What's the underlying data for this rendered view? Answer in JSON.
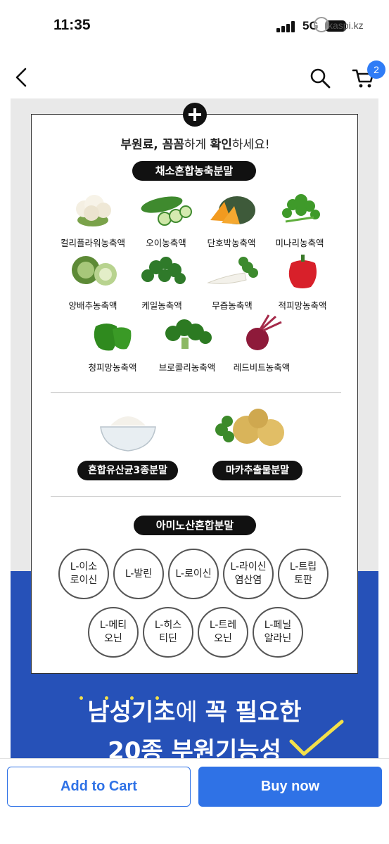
{
  "status_bar": {
    "time": "11:35",
    "network": "5G",
    "watermark": "kaspi.kz"
  },
  "header": {
    "cart_count": "2",
    "icons": [
      "back-arrow-icon",
      "search-icon",
      "cart-icon"
    ]
  },
  "product_image": {
    "subtitle": {
      "part1": "부원료, ",
      "part2": "꼼꼼",
      "part3": "하게 ",
      "part4": "확인",
      "part5": "하세요!"
    },
    "vegetable_section": {
      "title": "채소혼합농축분말",
      "items": [
        {
          "name": "컬리플라워농축액",
          "icon": "cauliflower"
        },
        {
          "name": "오이농축액",
          "icon": "cucumber"
        },
        {
          "name": "단호박농축액",
          "icon": "pumpkin"
        },
        {
          "name": "미나리농축액",
          "icon": "water-parsley"
        },
        {
          "name": "양배추농축액",
          "icon": "cabbage"
        },
        {
          "name": "케일농축액",
          "icon": "kale"
        },
        {
          "name": "무즙농축액",
          "icon": "radish"
        },
        {
          "name": "적피망농축액",
          "icon": "red-pepper"
        },
        {
          "name": "청피망농축액",
          "icon": "green-pepper"
        },
        {
          "name": "브로콜리농축액",
          "icon": "broccoli"
        },
        {
          "name": "레드비트농축액",
          "icon": "beet"
        }
      ]
    },
    "powder_items": [
      {
        "label": "혼합유산균3종분말",
        "icon": "powder-bowl"
      },
      {
        "label": "마카추출물분말",
        "icon": "maca-root"
      }
    ],
    "amino_section": {
      "title": "아미노산혼합분말",
      "items": [
        "L-이소\n로이신",
        "L-발린",
        "L-로이신",
        "L-라이신\n염산염",
        "L-트립\n토판",
        "L-메티\n오닌",
        "L-히스\n티딘",
        "L-트레\n오닌",
        "L-페닐\n알라닌"
      ]
    },
    "promo": {
      "line1_a": "남성기초",
      "line1_b": "에 ",
      "line1_c": "꼭 필요한",
      "line2": "20종 부원기능성"
    },
    "colors": {
      "blue_band": "#2651b8",
      "accent_yellow": "#f3e04a"
    }
  },
  "actions": {
    "add_to_cart": "Add to Cart",
    "buy_now": "Buy now",
    "accent": "#2f72e6"
  }
}
